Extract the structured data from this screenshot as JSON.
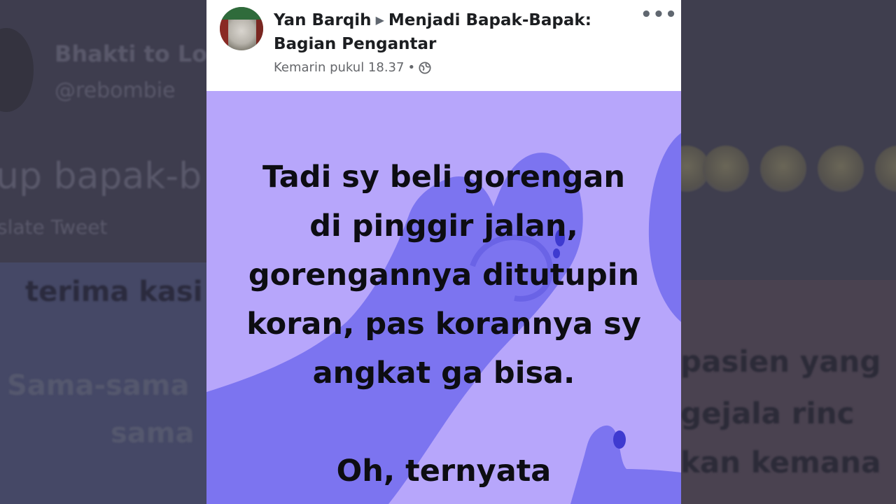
{
  "background": {
    "left_name": "Bhakti to Lo",
    "left_handle": "@rebombie",
    "left_tweet": "up bapak-b",
    "left_translate": "slate Tweet",
    "left_line1": "terima kasi",
    "left_line2": "Sama-sama",
    "left_line3": "sama",
    "right_line1": "pasien yang",
    "right_line2": "gejala rinc",
    "right_line3": "kan kemana"
  },
  "post": {
    "author": "Yan Barqih",
    "group": "Menjadi Bapak-Bapak: Bagian Pengantar",
    "timestamp": "Kemarin pukul 18.37",
    "text": "Tadi sy beli gorengan\ndi pinggir jalan,\ngorengannya ditutupin\nkoran, pas korannya sy\nangkat ga bisa.\n\nOh, ternyata",
    "icons": {
      "privacy": "globe-icon",
      "more": "more-options-icon"
    }
  },
  "colors": {
    "post_background": "#b7a6fb",
    "hand_shape": "#7c74f0"
  }
}
